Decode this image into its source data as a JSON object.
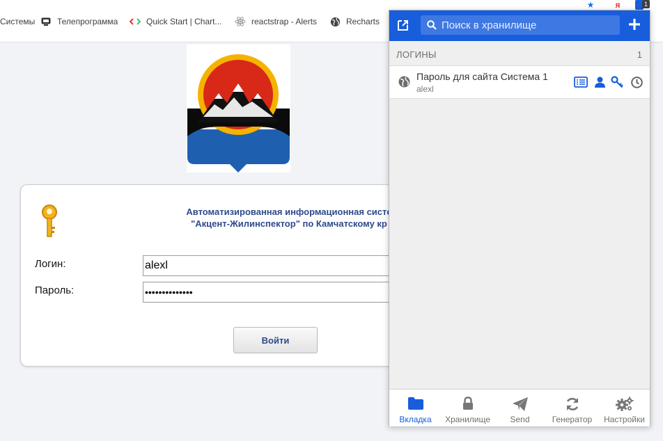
{
  "bookmarks": [
    {
      "label": "Системы",
      "icon": "none"
    },
    {
      "label": "Телепрограмма",
      "icon": "tv-icon"
    },
    {
      "label": "Quick Start | Chart...",
      "icon": "code-icon"
    },
    {
      "label": "reactstrap - Alerts",
      "icon": "atom-icon"
    },
    {
      "label": "Recharts",
      "icon": "globe-icon"
    }
  ],
  "page": {
    "title_line1": "Автоматизированная информационная систе",
    "title_line2": "\"Акцент-Жилинспектор\" по Камчатскому кр",
    "login_label": "Логин:",
    "login_value": "alexl",
    "password_label": "Пароль:",
    "password_mask": "••••••••••••••",
    "submit_label": "Войти"
  },
  "popup": {
    "search_placeholder": "Поиск в хранилище",
    "section_title": "ЛОГИНЫ",
    "section_count": "1",
    "item": {
      "name": "Пароль для сайта Система 1",
      "username": "alexl"
    },
    "nav": [
      {
        "label": "Вкладка",
        "icon": "folder-icon",
        "active": true
      },
      {
        "label": "Хранилище",
        "icon": "lock-icon",
        "active": false
      },
      {
        "label": "Send",
        "icon": "send-icon",
        "active": false
      },
      {
        "label": "Генератор",
        "icon": "refresh-icon",
        "active": false
      },
      {
        "label": "Настройки",
        "icon": "gears-icon",
        "active": false
      }
    ],
    "extension_badge": "1"
  },
  "colors": {
    "accent": "#175ddc",
    "page_title": "#2e4a8a"
  }
}
